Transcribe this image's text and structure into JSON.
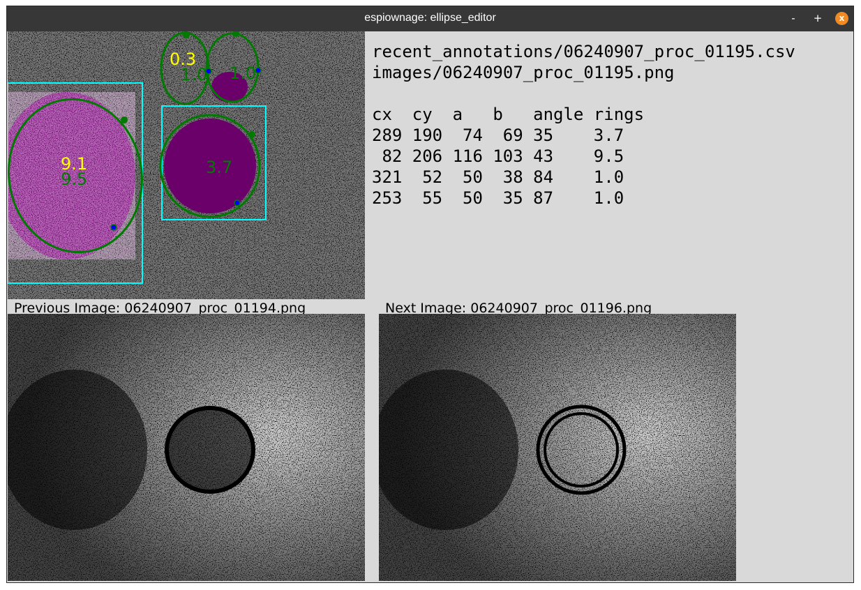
{
  "window": {
    "title": "espiownage: ellipse_editor",
    "minimize_label": "-",
    "maximize_label": "+",
    "close_label": "x"
  },
  "info": {
    "csv_path": "recent_annotations/06240907_proc_01195.csv",
    "image_path": "images/06240907_proc_01195.png",
    "columns": [
      "cx",
      "cy",
      "a",
      "b",
      "angle",
      "rings"
    ],
    "rows": [
      [
        "289",
        "190",
        "74",
        "69",
        "35",
        "3.7"
      ],
      [
        "82",
        "206",
        "116",
        "103",
        "43",
        "9.5"
      ],
      [
        "321",
        "52",
        "50",
        "38",
        "84",
        "1.0"
      ],
      [
        "253",
        "55",
        "50",
        "35",
        "87",
        "1.0"
      ]
    ]
  },
  "main_image": {
    "labels_yellow": [
      "0.3",
      "9.1"
    ],
    "labels_green": [
      "1.0",
      "1.0",
      "9.5",
      "3.7"
    ],
    "colors": {
      "ellipse": "#007a00",
      "box": "#00ffff",
      "handle": "#0000ff",
      "yellow": "#ffff00",
      "blob": "#8b008b"
    }
  },
  "previous": {
    "label": "Previous Image: 06240907_proc_01194.png"
  },
  "next": {
    "label": "Next Image: 06240907_proc_01196.png"
  }
}
